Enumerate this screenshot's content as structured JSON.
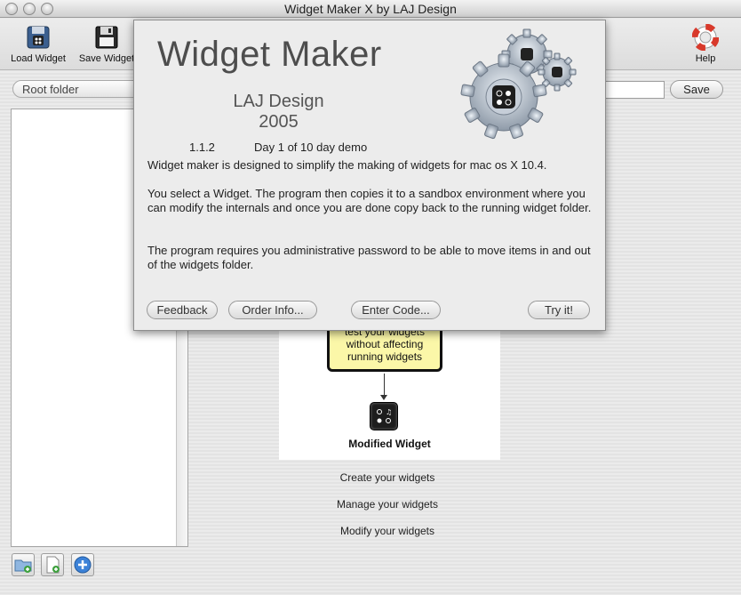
{
  "window": {
    "title": "Widget Maker X by LAJ Design"
  },
  "toolbar": {
    "load_label": "Load Widget",
    "save_label": "Save Widget",
    "help_label": "Help"
  },
  "sidebar": {
    "folder_selected": "Root folder"
  },
  "header": {
    "save_button": "Save"
  },
  "diagram": {
    "note_lines": [
      "test your widgets",
      "without affecting",
      "running widgets"
    ],
    "modified_label": "Modified Widget"
  },
  "features": [
    "Create your widgets",
    "Manage your widgets",
    "Modify your widgets"
  ],
  "about": {
    "title": "Widget Maker",
    "company": "LAJ Design",
    "year": "2005",
    "version": "1.1.2",
    "demo_status": "Day 1 of 10 day demo",
    "paragraphs": [
      "Widget maker is designed to simplify the making of widgets for mac os X 10.4.",
      "You select a Widget. The program then copies it to a sandbox environment where you can modify the internals and once you are done copy back to the running widget folder.",
      "The program requires you administrative password to be able to move items in and out of the widgets folder."
    ],
    "buttons": {
      "feedback": "Feedback",
      "order_info": "Order Info...",
      "enter_code": "Enter Code...",
      "try_it": "Try it!"
    }
  },
  "colors": {
    "note_fill": "#fbf7a8",
    "help_ring": "#d8392b"
  },
  "icons": {
    "load": "floppy-widget-icon",
    "save": "floppy-disk-icon",
    "help": "lifebuoy-icon",
    "new_folder": "new-folder-icon",
    "new_file": "new-file-icon",
    "add": "plus-circle-icon"
  }
}
